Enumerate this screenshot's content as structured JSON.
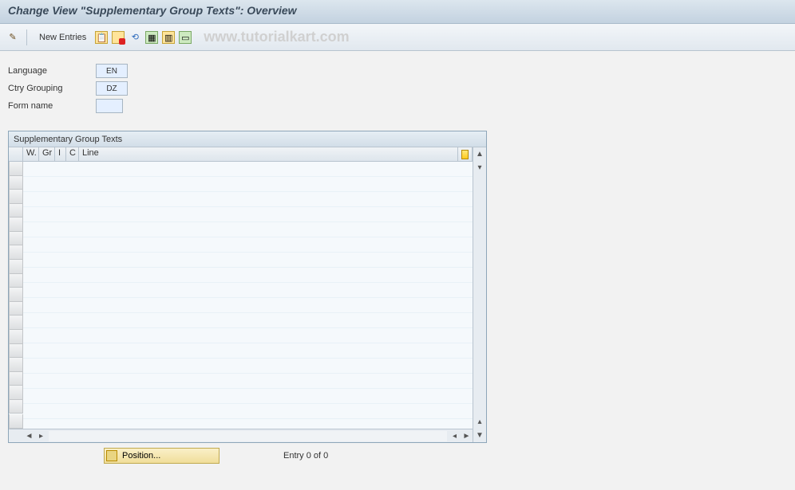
{
  "title": "Change View \"Supplementary Group Texts\": Overview",
  "toolbar": {
    "new_entries": "New Entries"
  },
  "watermark": "www.tutorialkart.com",
  "header": {
    "language_label": "Language",
    "language_value": "EN",
    "ctry_label": "Ctry Grouping",
    "ctry_value": "DZ",
    "form_label": "Form name",
    "form_value": ""
  },
  "panel": {
    "title": "Supplementary Group Texts",
    "columns": {
      "w": "W.",
      "gr": "Gr",
      "i": "I",
      "c": "C",
      "line": "Line"
    }
  },
  "footer": {
    "position_label": "Position...",
    "entry_text": "Entry 0 of 0"
  },
  "icons": {
    "pencil": "pencil-icon",
    "copy": "copy-icon",
    "save": "save-icon",
    "undo": "undo-icon",
    "sel1": "select-icon",
    "sel2": "select-block-icon",
    "sel3": "deselect-icon"
  }
}
